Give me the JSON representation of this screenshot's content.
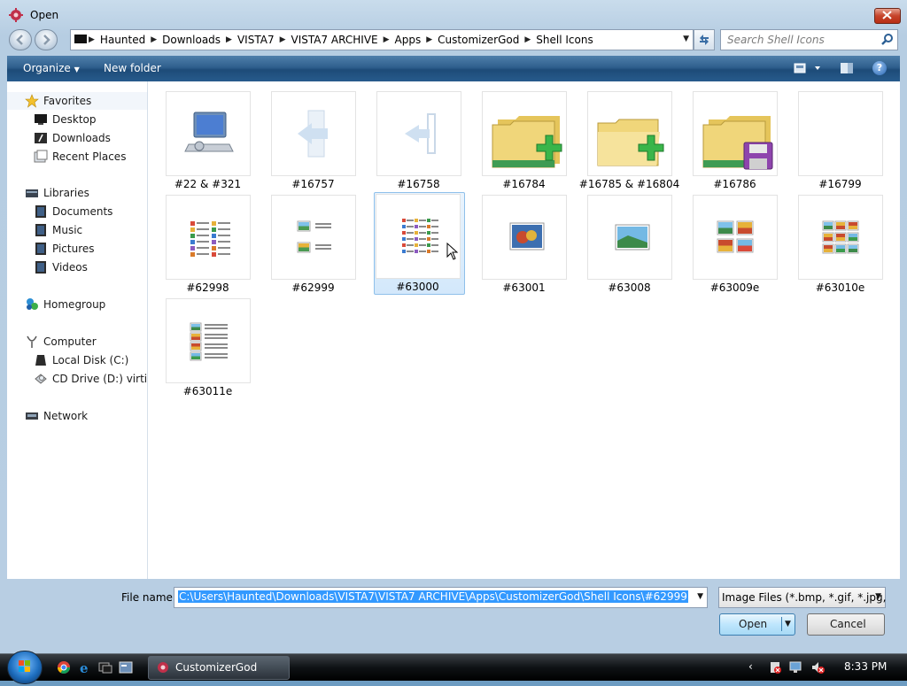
{
  "window": {
    "title": "Open"
  },
  "address": {
    "crumbs": [
      "Haunted",
      "Downloads",
      "VISTA7",
      "VISTA7 ARCHIVE",
      "Apps",
      "CustomizerGod",
      "Shell Icons"
    ]
  },
  "search": {
    "placeholder": "Search Shell Icons"
  },
  "toolbar": {
    "organize": "Organize",
    "new_folder": "New folder",
    "help": "?"
  },
  "nav": {
    "favorites": "Favorites",
    "fav_items": [
      "Desktop",
      "Downloads",
      "Recent Places"
    ],
    "libraries": "Libraries",
    "lib_items": [
      "Documents",
      "Music",
      "Pictures",
      "Videos"
    ],
    "homegroup": "Homegroup",
    "computer": "Computer",
    "comp_items": [
      "Local Disk (C:)",
      "CD Drive (D:) virtio-w"
    ],
    "network": "Network"
  },
  "files": [
    {
      "label": "#22 & #321",
      "icon": "computer-icon"
    },
    {
      "label": "#16757",
      "icon": "arrow-into-panel-icon"
    },
    {
      "label": "#16758",
      "icon": "arrow-out-panel-icon"
    },
    {
      "label": "#16784",
      "icon": "folders-add-icon"
    },
    {
      "label": "#16785 & #16804",
      "icon": "folder-add-icon"
    },
    {
      "label": "#16786",
      "icon": "folders-save-icon"
    },
    {
      "label": "#16799",
      "icon": "blank-icon"
    },
    {
      "label": "#62998",
      "icon": "details-list-icon"
    },
    {
      "label": "#62999",
      "icon": "tiles-view-icon"
    },
    {
      "label": "#63000",
      "icon": "list-view-icon"
    },
    {
      "label": "#63001",
      "icon": "large-photo-icon"
    },
    {
      "label": "#63008",
      "icon": "medium-photo-icon"
    },
    {
      "label": "#63009e",
      "icon": "small-photos-icon"
    },
    {
      "label": "#63010e",
      "icon": "photo-grid-icon"
    },
    {
      "label": "#63011e",
      "icon": "content-view-icon"
    }
  ],
  "selected_file": "#63000",
  "bottom": {
    "file_name_label": "File name:",
    "file_name_value": "C:\\Users\\Haunted\\Downloads\\VISTA7\\VISTA7 ARCHIVE\\Apps\\CustomizerGod\\Shell Icons\\#62999",
    "filter": "Image Files (*.bmp, *.gif, *.jpg,",
    "open": "Open",
    "cancel": "Cancel"
  },
  "taskbar": {
    "task": "CustomizerGod",
    "clock": "8:33 PM"
  },
  "colors": {
    "accent": "#3399ff",
    "toolbar": "#2f5f8d",
    "close": "#c6432a"
  }
}
